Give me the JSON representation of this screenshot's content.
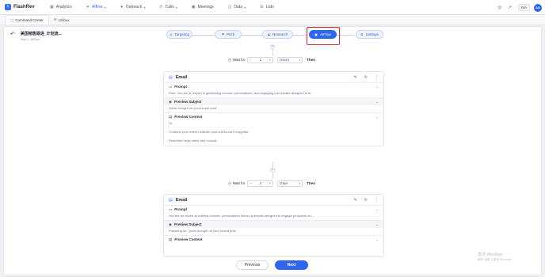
{
  "app": {
    "name": "FlashRev"
  },
  "nav": {
    "items": [
      {
        "label": "Analytics",
        "icon": "chart-icon",
        "has_menu": false
      },
      {
        "label": "AIflow",
        "icon": "sparkle-icon",
        "has_menu": true
      },
      {
        "label": "Outreach",
        "icon": "send-icon",
        "has_menu": true
      },
      {
        "label": "Calls",
        "icon": "phone-icon",
        "has_menu": true
      },
      {
        "label": "Meetings",
        "icon": "calendar-icon",
        "has_menu": false
      },
      {
        "label": "Data",
        "icon": "database-icon",
        "has_menu": true
      },
      {
        "label": "Lists",
        "icon": "list-icon",
        "has_menu": false
      }
    ],
    "active_item": "AIflow",
    "language": "MA",
    "avatar_initials": "AD"
  },
  "subtabs": [
    {
      "label": "Command Center",
      "icon": "command-icon"
    },
    {
      "label": "Unibox",
      "icon": "inbox-icon"
    }
  ],
  "campaign": {
    "title": "美国销售跟进_计划流...",
    "subtitle": "Step 4 · AIFlow"
  },
  "steps": [
    {
      "label": "Targeting",
      "icon": "target-icon"
    },
    {
      "label": "Pitch",
      "icon": "flag-icon"
    },
    {
      "label": "Research",
      "icon": "user-search-icon"
    },
    {
      "label": "AIFlow",
      "icon": "flow-icon"
    },
    {
      "label": "Settings",
      "icon": "gear-icon"
    }
  ],
  "active_step": "AIFlow",
  "waits": [
    {
      "label": "Wait for",
      "value": "1",
      "unit": "Hours",
      "then": "Then"
    },
    {
      "label": "Wait for",
      "value": "3",
      "unit": "Days",
      "then": "Then"
    }
  ],
  "emails": [
    {
      "title": "Email",
      "prompt_label": "Prompt",
      "prompt_text": "Role: You are an expert in generating concise, personalized, and engaging cold emails designed to st...",
      "subject_label": "Preview Subject",
      "subject_text": "Quick thought on your recent post",
      "content_label": "Preview Content",
      "content_lines": [
        "Hi,",
        "I noticed your recent LinkedIn post and found it insightful.",
        "FlashIntel helps sales and consult..."
      ]
    },
    {
      "title": "Email",
      "prompt_label": "Prompt",
      "prompt_text": "You are an expert at crafting concise, personalized follow-up emails designed to engage prospects an...",
      "subject_label": "Preview Subject",
      "subject_text": "Following up: Quick thought on your recent post",
      "content_label": "Preview Content"
    }
  ],
  "footer": {
    "previous_label": "Previous",
    "next_label": "Next"
  },
  "watermark": {
    "line1": "激活 Windows",
    "line2": "转到\"设置\"以激活 Windows。"
  },
  "colors": {
    "accent": "#2f66f0",
    "highlight": "#d9272e"
  }
}
